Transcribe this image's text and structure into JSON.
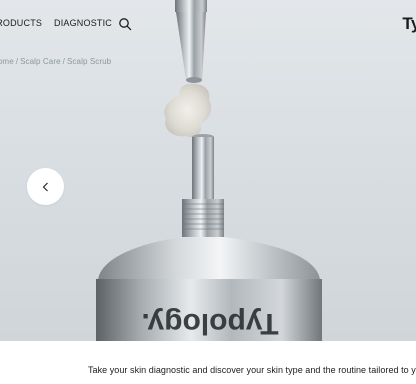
{
  "nav": {
    "products_label": "PRODUCTS",
    "diagnostic_label": "DIAGNOSTIC",
    "search_icon": "search-icon",
    "logo_text": "Ty"
  },
  "breadcrumb": {
    "items": [
      "Home",
      "Scalp Care",
      "Scalp Scrub"
    ],
    "separator": "/"
  },
  "carousel": {
    "prev_icon": "chevron-left-icon"
  },
  "hero": {
    "tube_print": "Typology."
  },
  "promo": {
    "text": "Take your skin diagnostic and discover your skin type and the routine tailored to your"
  },
  "colors": {
    "text": "#1c1c1c",
    "muted": "#8f969b",
    "background": "#ffffff"
  }
}
